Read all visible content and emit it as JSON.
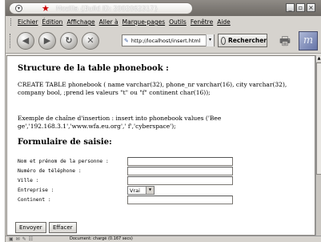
{
  "window": {
    "title": "Mozilla {Build ID: 2002062317}"
  },
  "menubar": {
    "items": [
      {
        "label": "Eichier"
      },
      {
        "label": "Édition"
      },
      {
        "label": "Affichage"
      },
      {
        "label": "Aller à"
      },
      {
        "label": "Marque-pages"
      },
      {
        "label": "Outils"
      },
      {
        "label": "Fenêtre"
      },
      {
        "label": "Aide"
      }
    ]
  },
  "toolbar": {
    "url": "http://localhost/insert.html",
    "search_label": "Rechercher"
  },
  "page": {
    "heading_structure": "Structure de la table phonebook :",
    "create_statement": "CREATE TABLE phonebook ( name varchar(32), phone_nr varchar(16), city varchar(32), company bool, ;prend les valeurs \"t\" ou \"f\" continent char(16));",
    "example_statement": "Exemple de chaîne d'insertion : insert into phonebook values ('Bee ge','192.168.3.1','www.wfa.eu.org',' f','cyberspace');",
    "heading_form": "Formulaire de saisie:",
    "form": {
      "label_name": "Nom et prénom de la personne :",
      "label_phone": "Numéro de téléphone :",
      "label_city": "Ville :",
      "label_company": "Entreprise :",
      "label_continent": "Continent :",
      "company_selected": "Vrai",
      "submit_label": "Envoyer",
      "reset_label": "Effacer"
    }
  },
  "status": {
    "text": "Document: chargé (0.167 secs)"
  }
}
